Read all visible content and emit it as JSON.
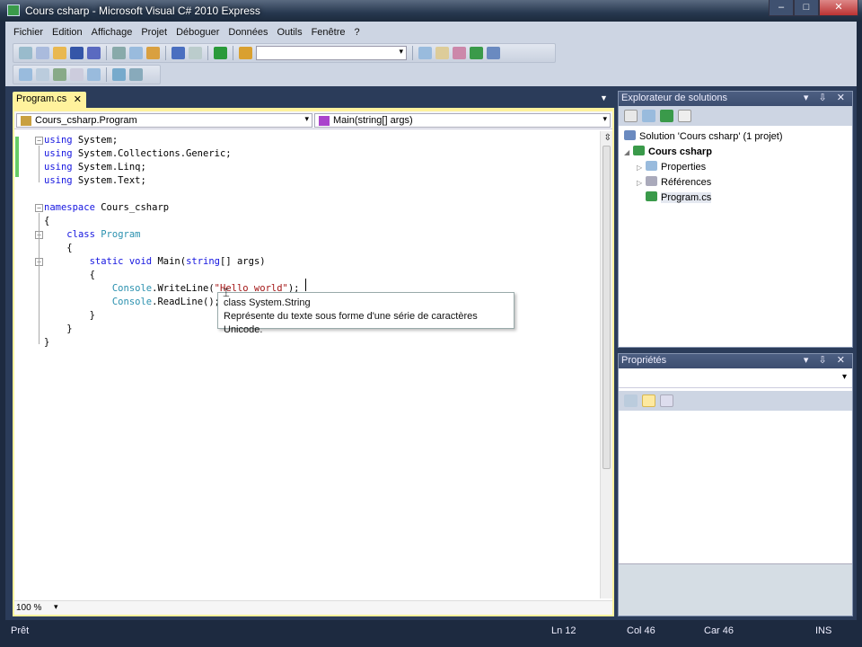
{
  "window": {
    "title": "Cours csharp - Microsoft Visual C# 2010 Express",
    "min": "–",
    "max": "□",
    "close": "✕"
  },
  "menu": [
    "Fichier",
    "Edition",
    "Affichage",
    "Projet",
    "Déboguer",
    "Données",
    "Outils",
    "Fenêtre",
    "?"
  ],
  "tab": {
    "label": "Program.cs",
    "close": "✕"
  },
  "nav": {
    "type": "Cours_csharp.Program",
    "member": "Main(string[] args)"
  },
  "code": [
    [
      [
        "using",
        "kw"
      ],
      [
        " System;",
        ""
      ]
    ],
    [
      [
        "using",
        "kw"
      ],
      [
        " System.Collections.Generic;",
        ""
      ]
    ],
    [
      [
        "using",
        "kw"
      ],
      [
        " System.Linq;",
        ""
      ]
    ],
    [
      [
        "using",
        "kw"
      ],
      [
        " System.Text;",
        ""
      ]
    ],
    [],
    [
      [
        "namespace",
        "kw"
      ],
      [
        " Cours_csharp",
        ""
      ]
    ],
    [
      [
        "{",
        ""
      ]
    ],
    [
      [
        "    ",
        ""
      ],
      [
        "class",
        "kw"
      ],
      [
        " ",
        ""
      ],
      [
        "Program",
        "ty"
      ]
    ],
    [
      [
        "    {",
        ""
      ]
    ],
    [
      [
        "        ",
        ""
      ],
      [
        "static",
        "kw"
      ],
      [
        " ",
        ""
      ],
      [
        "void",
        "kw"
      ],
      [
        " Main(",
        ""
      ],
      [
        "string",
        "kw"
      ],
      [
        "[] args)",
        ""
      ]
    ],
    [
      [
        "        {",
        ""
      ]
    ],
    [
      [
        "            ",
        ""
      ],
      [
        "Console",
        "ty"
      ],
      [
        ".WriteLine(",
        ""
      ],
      [
        "\"Hello world\"",
        "st"
      ],
      [
        ");",
        ""
      ]
    ],
    [
      [
        "            ",
        ""
      ],
      [
        "Console",
        "ty"
      ],
      [
        ".ReadLine();",
        ""
      ]
    ],
    [
      [
        "        }",
        ""
      ]
    ],
    [
      [
        "    }",
        ""
      ]
    ],
    [
      [
        "}",
        ""
      ]
    ]
  ],
  "tooltip": {
    "title": "class System.String",
    "description": "Représente du texte sous forme d'une série de caractères Unicode."
  },
  "editor": {
    "zoom": "100 %"
  },
  "solution_explorer": {
    "title": "Explorateur de solutions",
    "controls": "▾ ⇩ ✕",
    "items": [
      {
        "label": "Solution 'Cours csharp' (1 projet)",
        "expander": ""
      },
      {
        "label": "Cours csharp",
        "expander": "◢"
      },
      {
        "label": "Properties",
        "expander": "▷"
      },
      {
        "label": "Références",
        "expander": "▷"
      },
      {
        "label": "Program.cs",
        "expander": ""
      }
    ]
  },
  "properties": {
    "title": "Propriétés",
    "controls": "▾ ⇩ ✕"
  },
  "status": {
    "ready": "Prêt",
    "line": "Ln 12",
    "col": "Col 46",
    "car": "Car 46",
    "mode": "INS"
  }
}
